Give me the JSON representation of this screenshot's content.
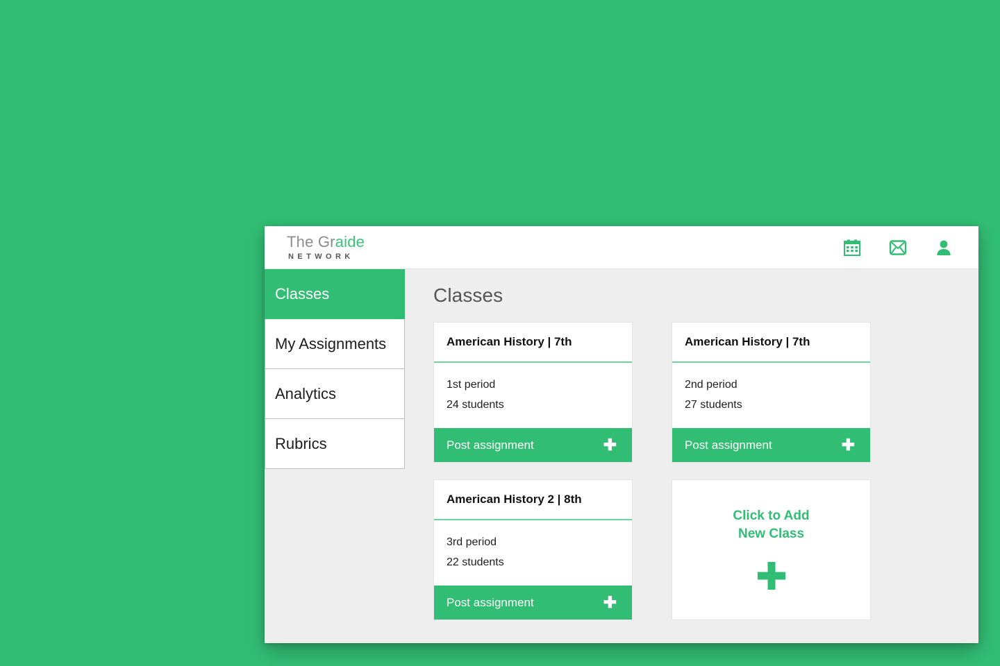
{
  "brand": {
    "name_plain": "The Gr",
    "name_accent": "aide",
    "subtitle": "NETWORK"
  },
  "topbar": {
    "icons": [
      {
        "name": "calendar-icon",
        "label": "Calendar"
      },
      {
        "name": "mail-icon",
        "label": "Messages"
      },
      {
        "name": "user-icon",
        "label": "Account"
      }
    ]
  },
  "sidebar": {
    "items": [
      {
        "label": "Classes",
        "active": true
      },
      {
        "label": "My Assignments",
        "active": false
      },
      {
        "label": "Analytics",
        "active": false
      },
      {
        "label": "Rubrics",
        "active": false
      }
    ]
  },
  "main": {
    "page_title": "Classes",
    "cards": [
      {
        "title": "American History | 7th",
        "period": "1st period",
        "students": "24 students",
        "action_label": "Post assignment",
        "action_icon": "plus-icon"
      },
      {
        "title": "American History | 7th",
        "period": "2nd period",
        "students": "27 students",
        "action_label": "Post assignment",
        "action_icon": "plus-icon"
      },
      {
        "title": "American History 2 | 8th",
        "period": "3rd period",
        "students": "22 students",
        "action_label": "Post assignment",
        "action_icon": "plus-icon"
      }
    ],
    "add_card": {
      "line1": "Click to Add",
      "line2": "New Class",
      "icon": "plus-icon"
    }
  },
  "colors": {
    "background_green": "#32bd74",
    "accent_green": "#32bd74",
    "divider_green": "#6ed49c",
    "content_gray": "#eeeeee",
    "title_gray": "#555555"
  }
}
